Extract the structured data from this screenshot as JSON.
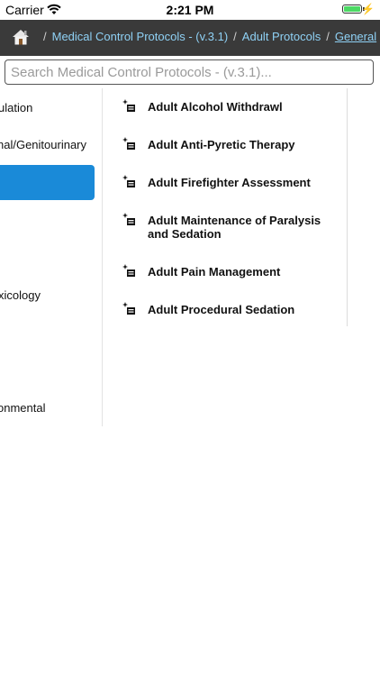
{
  "status_bar": {
    "carrier": "Carrier",
    "time": "2:21 PM",
    "battery_color": "#4cd964"
  },
  "nav": {
    "background": "#3a3a3a",
    "home_icon": "home-icon",
    "separator": "/",
    "crumbs": [
      "Medical Control Protocols - (v.3.1)",
      "Adult Protocols",
      "General"
    ],
    "link_color": "#8fd1f5"
  },
  "search": {
    "placeholder": "Search Medical Control Protocols - (v.3.1)..."
  },
  "categories": {
    "selected_color": "#1a8ad8",
    "items": [
      "ulation",
      "nal/Genitourinary",
      "xicology",
      "onmental"
    ]
  },
  "protocols": {
    "icon": "protocol-doc-icon",
    "items": [
      "Adult Alcohol Withdrawl",
      "Adult Anti-Pyretic Therapy",
      "Adult Firefighter Assessment",
      "Adult Maintenance of Paralysis and Sedation",
      "Adult Pain Management",
      "Adult Procedural Sedation"
    ]
  }
}
